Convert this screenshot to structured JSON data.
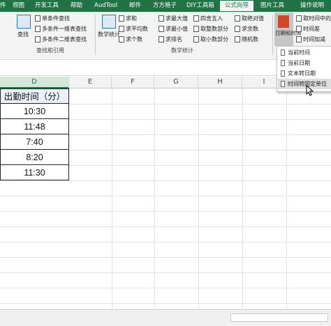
{
  "tabs": [
    "件",
    "视图",
    "开发工具",
    "帮助",
    "AudTool",
    "邮件",
    "方方格子",
    "DIY工具箱",
    "公式向导",
    "图片工具",
    "操作说明"
  ],
  "active_tab": "公式向导",
  "ribbon": {
    "left_big": "查找",
    "left_items": [
      "单条件查找",
      "多条件一维表查找",
      "多条件二维表查找"
    ],
    "group_lookup": "查找和引用",
    "stat_big": "数学统计",
    "stat_items": [
      "求和",
      "求平均数",
      "求个数"
    ],
    "stat2_items": [
      "求最大值",
      "求最小值",
      "求排名"
    ],
    "stat3_items": [
      "四舍五入",
      "取整数部分",
      "取小数部分"
    ],
    "stat4_items": [
      "取绝对值",
      "求余数",
      "随机数"
    ],
    "group_stat": "数学统计",
    "date_big": "日期和时间",
    "date_items": [
      "取时间中的",
      "时间差",
      "时间加减"
    ]
  },
  "dropdown": [
    "当前时间",
    "当前日期",
    "文本转日期",
    "时间转固定单位"
  ],
  "columns": [
    "D",
    "E",
    "F",
    "G",
    "H",
    "I"
  ],
  "table": {
    "header": "出勤时间（分）",
    "rows": [
      "10:30",
      "11:48",
      "7:40",
      "8:20",
      "11:30"
    ]
  }
}
